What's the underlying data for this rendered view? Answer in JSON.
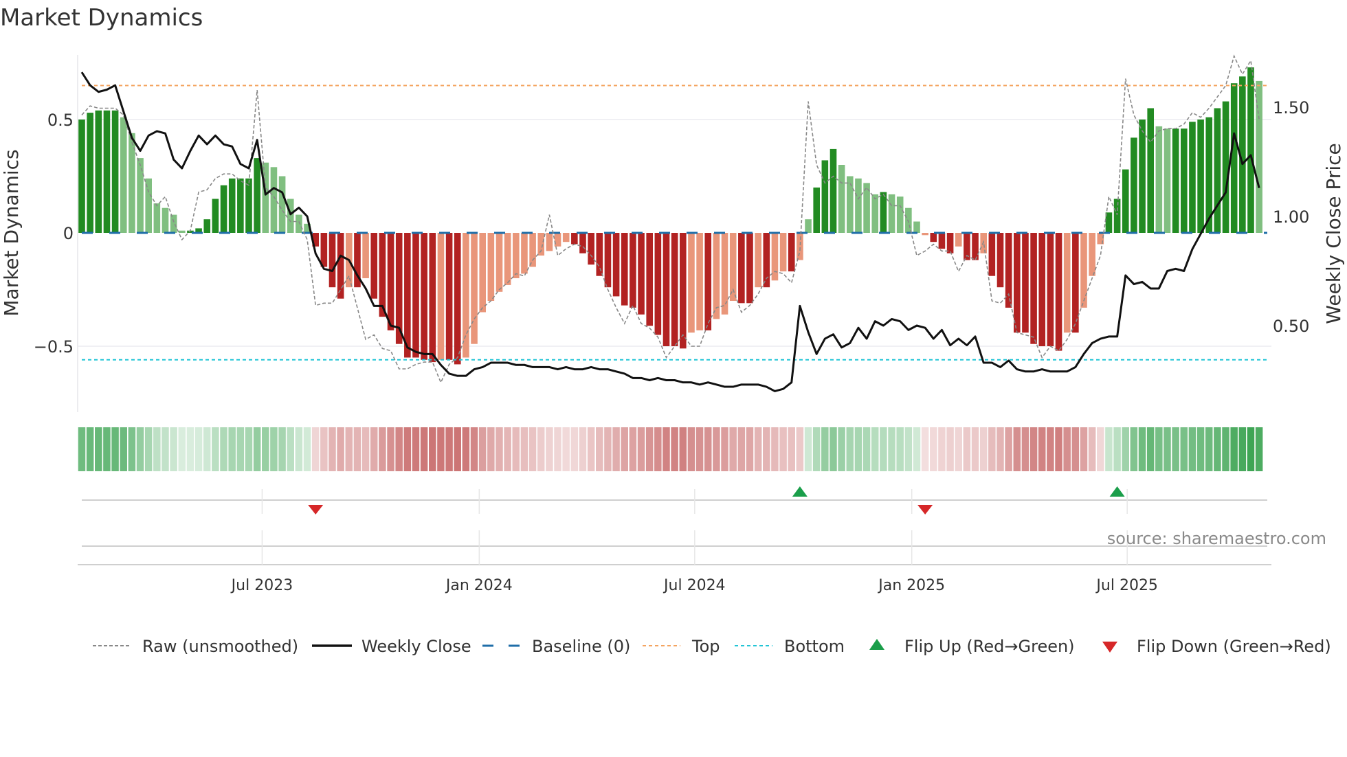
{
  "title": "Market Dynamics",
  "source": "source: sharemaestro.com",
  "colors": {
    "up_strong": "#228b22",
    "up_weak": "#80bf80",
    "down_strong": "#b22222",
    "down_weak": "#e9967a",
    "raw": "#888888",
    "close": "#111111",
    "baseline": "#1f6ea8",
    "top": "#f4a460",
    "bottom": "#22c5d6",
    "flip_up": "#1a9e4a",
    "flip_down": "#d62728"
  },
  "chart_data": {
    "type": "bar",
    "title": "Market Dynamics",
    "ylabel": "Market Dynamics",
    "y2label": "Weekly Close Price",
    "ylim": [
      -0.79,
      0.78
    ],
    "y2lim": [
      0.1,
      1.74
    ],
    "yticks": [
      {
        "value": 0.5,
        "label": "0.5"
      },
      {
        "value": 0,
        "label": "0"
      },
      {
        "value": -0.5,
        "label": "−0.5"
      }
    ],
    "y2ticks": [
      {
        "value": 1.5,
        "label": "1.50"
      },
      {
        "value": 1.0,
        "label": "1.00"
      },
      {
        "value": 0.5,
        "label": "0.50"
      }
    ],
    "xticks": [
      {
        "index": 21.6,
        "label": "Jul 2023"
      },
      {
        "index": 47.6,
        "label": "Jan 2024"
      },
      {
        "index": 73.4,
        "label": "Jul 2024"
      },
      {
        "index": 99.4,
        "label": "Jan 2025"
      },
      {
        "index": 125.2,
        "label": "Jul 2025"
      }
    ],
    "top_level": 0.65,
    "bottom_level": -0.56,
    "baseline": 0,
    "smoothed": [
      0.5,
      0.53,
      0.54,
      0.54,
      0.54,
      0.51,
      0.44,
      0.33,
      0.24,
      0.13,
      0.11,
      0.08,
      0.01,
      0.01,
      0.02,
      0.06,
      0.15,
      0.21,
      0.24,
      0.24,
      0.24,
      0.33,
      0.31,
      0.29,
      0.25,
      0.15,
      0.08,
      0.04,
      -0.06,
      -0.15,
      -0.24,
      -0.29,
      -0.24,
      -0.24,
      -0.2,
      -0.29,
      -0.37,
      -0.43,
      -0.49,
      -0.55,
      -0.55,
      -0.56,
      -0.57,
      -0.56,
      -0.56,
      -0.58,
      -0.55,
      -0.49,
      -0.35,
      -0.3,
      -0.26,
      -0.23,
      -0.2,
      -0.18,
      -0.15,
      -0.1,
      -0.08,
      -0.06,
      -0.04,
      -0.05,
      -0.09,
      -0.14,
      -0.19,
      -0.24,
      -0.28,
      -0.32,
      -0.33,
      -0.36,
      -0.41,
      -0.45,
      -0.5,
      -0.5,
      -0.51,
      -0.44,
      -0.43,
      -0.43,
      -0.38,
      -0.36,
      -0.3,
      -0.31,
      -0.31,
      -0.24,
      -0.24,
      -0.21,
      -0.17,
      -0.17,
      -0.12,
      0.06,
      0.2,
      0.32,
      0.37,
      0.3,
      0.25,
      0.24,
      0.22,
      0.17,
      0.18,
      0.17,
      0.16,
      0.11,
      0.05,
      -0.01,
      -0.04,
      -0.07,
      -0.09,
      -0.06,
      -0.12,
      -0.12,
      -0.09,
      -0.19,
      -0.24,
      -0.33,
      -0.44,
      -0.44,
      -0.49,
      -0.5,
      -0.5,
      -0.52,
      -0.44,
      -0.44,
      -0.33,
      -0.19,
      -0.05,
      0.09,
      0.15,
      0.28,
      0.42,
      0.5,
      0.55,
      0.47,
      0.46,
      0.46,
      0.46,
      0.49,
      0.5,
      0.51,
      0.55,
      0.58,
      0.66,
      0.69,
      0.73,
      0.67
    ],
    "raw": [
      0.52,
      0.56,
      0.55,
      0.55,
      0.55,
      0.52,
      0.4,
      0.3,
      0.18,
      0.12,
      0.16,
      0.05,
      -0.03,
      0.01,
      0.18,
      0.19,
      0.24,
      0.26,
      0.26,
      0.23,
      0.21,
      0.63,
      0.2,
      0.16,
      0.1,
      0.05,
      0.05,
      -0.03,
      -0.32,
      -0.31,
      -0.31,
      -0.25,
      -0.19,
      -0.33,
      -0.47,
      -0.45,
      -0.51,
      -0.52,
      -0.6,
      -0.6,
      -0.58,
      -0.57,
      -0.57,
      -0.66,
      -0.58,
      -0.55,
      -0.45,
      -0.38,
      -0.33,
      -0.3,
      -0.25,
      -0.22,
      -0.18,
      -0.19,
      -0.12,
      -0.08,
      0.08,
      -0.1,
      -0.07,
      -0.05,
      -0.06,
      -0.1,
      -0.15,
      -0.25,
      -0.33,
      -0.4,
      -0.32,
      -0.4,
      -0.42,
      -0.46,
      -0.55,
      -0.5,
      -0.45,
      -0.5,
      -0.5,
      -0.4,
      -0.33,
      -0.32,
      -0.25,
      -0.35,
      -0.32,
      -0.27,
      -0.2,
      -0.17,
      -0.18,
      -0.22,
      -0.08,
      0.58,
      0.3,
      0.22,
      0.25,
      0.22,
      0.22,
      0.15,
      0.2,
      0.15,
      0.17,
      0.12,
      0.12,
      0.05,
      -0.1,
      -0.08,
      -0.05,
      -0.08,
      -0.08,
      -0.17,
      -0.1,
      -0.12,
      -0.04,
      -0.3,
      -0.31,
      -0.27,
      -0.44,
      -0.45,
      -0.46,
      -0.55,
      -0.5,
      -0.52,
      -0.47,
      -0.4,
      -0.3,
      -0.2,
      -0.1,
      0.16,
      0.08,
      0.68,
      0.52,
      0.45,
      0.4,
      0.45,
      0.46,
      0.46,
      0.48,
      0.53,
      0.51,
      0.55,
      0.6,
      0.65,
      0.78,
      0.7,
      0.76,
      0.5
    ],
    "close": [
      1.66,
      1.6,
      1.57,
      1.58,
      1.6,
      1.48,
      1.36,
      1.3,
      1.37,
      1.39,
      1.38,
      1.26,
      1.22,
      1.3,
      1.37,
      1.33,
      1.37,
      1.33,
      1.32,
      1.24,
      1.22,
      1.35,
      1.1,
      1.13,
      1.11,
      1.01,
      1.04,
      1.0,
      0.83,
      0.76,
      0.75,
      0.82,
      0.8,
      0.73,
      0.67,
      0.59,
      0.59,
      0.5,
      0.49,
      0.4,
      0.38,
      0.37,
      0.37,
      0.32,
      0.28,
      0.27,
      0.27,
      0.3,
      0.31,
      0.33,
      0.33,
      0.33,
      0.32,
      0.32,
      0.31,
      0.31,
      0.31,
      0.3,
      0.31,
      0.3,
      0.3,
      0.31,
      0.3,
      0.3,
      0.29,
      0.28,
      0.26,
      0.26,
      0.25,
      0.26,
      0.25,
      0.25,
      0.24,
      0.24,
      0.23,
      0.24,
      0.23,
      0.22,
      0.22,
      0.23,
      0.23,
      0.23,
      0.22,
      0.2,
      0.21,
      0.24,
      0.59,
      0.47,
      0.37,
      0.44,
      0.46,
      0.4,
      0.42,
      0.49,
      0.44,
      0.52,
      0.5,
      0.53,
      0.52,
      0.48,
      0.5,
      0.49,
      0.44,
      0.48,
      0.41,
      0.44,
      0.41,
      0.45,
      0.33,
      0.33,
      0.31,
      0.34,
      0.3,
      0.29,
      0.29,
      0.3,
      0.29,
      0.29,
      0.29,
      0.31,
      0.37,
      0.42,
      0.44,
      0.45,
      0.45,
      0.73,
      0.69,
      0.7,
      0.67,
      0.67,
      0.75,
      0.76,
      0.75,
      0.85,
      0.92,
      0.99,
      1.05,
      1.11,
      1.38,
      1.24,
      1.28,
      1.13
    ],
    "flips": [
      {
        "index": 28,
        "type": "down"
      },
      {
        "index": 86,
        "type": "up"
      },
      {
        "index": 101,
        "type": "down"
      },
      {
        "index": 124,
        "type": "up"
      }
    ],
    "legend": {
      "placement": "bottom",
      "items": [
        {
          "key": "raw",
          "label": "Raw (unsmoothed)"
        },
        {
          "key": "close",
          "label": "Weekly Close"
        },
        {
          "key": "baseline",
          "label": "Baseline (0)"
        },
        {
          "key": "top",
          "label": "Top"
        },
        {
          "key": "bottom",
          "label": "Bottom"
        },
        {
          "key": "flip_up",
          "label": "Flip Up (Red→Green)"
        },
        {
          "key": "flip_down",
          "label": "Flip Down (Green→Red)"
        }
      ]
    }
  }
}
